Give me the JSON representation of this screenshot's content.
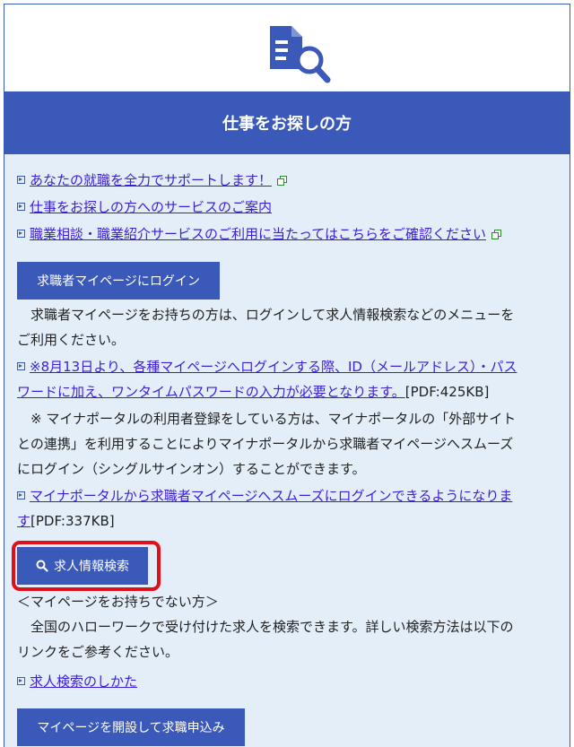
{
  "header": {
    "title": "仕事をお探しの方",
    "icon": "document-search-icon"
  },
  "links_top": [
    {
      "text": "あなたの就職を全力でサポートします！",
      "external": true
    },
    {
      "text": "仕事をお探しの方へのサービスのご案内",
      "external": false
    },
    {
      "text": "職業相談・職業紹介サービスのご利用に当たってはこちらをご確認ください",
      "external": true
    }
  ],
  "login_button": {
    "label": "求職者マイページにログイン"
  },
  "login_desc": {
    "line1": "　求職者マイページをお持ちの方は、ログインして求人情報検索などのメニューを",
    "line2": "ご利用ください。"
  },
  "notice_link": {
    "line1": "※8月13日より、各種マイページへログインする際、ID（メールアドレス）・パス",
    "line2": "ワードに加え、ワンタイムパスワードの入力が必要となります。",
    "pdf": "[PDF:425KB]"
  },
  "myna_desc": {
    "line1": "　※ マイナポータルの利用者登録をしている方は、マイナポータルの「外部サイト",
    "line2": "との連携」を利用することによりマイナポータルから求職者マイページへスムーズ",
    "line3": "にログイン（シングルサインオン）することができます。"
  },
  "myna_link": {
    "line1": "マイナポータルから求職者マイページへスムーズにログインできるようになりま",
    "line2": "す",
    "pdf": "[PDF:337KB]"
  },
  "search_button": {
    "label": "求人情報検索",
    "icon": "search-icon"
  },
  "no_mypage": {
    "heading": "＜マイページをお持ちでない方＞",
    "line1": "　全国のハローワークで受け付けた求人を検索できます。詳しい検索方法は以下の",
    "line2": "リンクをご参考ください。"
  },
  "howto_link": {
    "text": "求人検索のしかた"
  },
  "register_button": {
    "label": "マイページを開設して求職申込み"
  },
  "colors": {
    "primary": "#3a59b8",
    "link": "#3d1fd6",
    "highlight": "#e0101a",
    "panel_bg": "#e3eef9"
  }
}
